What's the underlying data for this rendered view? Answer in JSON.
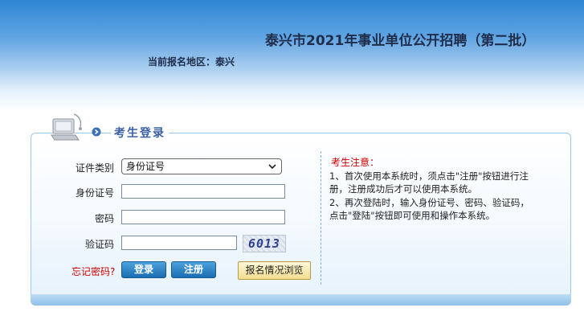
{
  "header": {
    "title": "泰兴市2021年事业单位公开招聘（第二批）",
    "region_label": "当前报名地区：",
    "region_value": "泰兴"
  },
  "login": {
    "title": "考生登录",
    "fields": {
      "id_type_label": "证件类别",
      "id_type_value": "身份证号",
      "id_number_label": "身份证号",
      "id_number_value": "",
      "password_label": "密码",
      "password_value": "",
      "captcha_label": "验证码",
      "captcha_value": "",
      "captcha_code": "6013"
    },
    "forgot_password": "忘记密码?",
    "login_button": "登录",
    "register_button": "注册",
    "browse_button": "报名情况浏览"
  },
  "notice": {
    "title": "考生注意：",
    "lines": [
      "1、首次使用本系统时，须点击\"注册\"按钮进行注",
      "册，注册成功后才可以使用本系统。",
      "2、再次登陆时，输入身份证号、密码、验证码，",
      "点击\"登陆\"按钮即可使用和操作本系统。"
    ]
  },
  "colors": {
    "header_top": "#2f86d3",
    "title_text": "#1f2d4a",
    "panel_border": "#9ec8ea",
    "accent_blue": "#1a6db3",
    "notice_red": "#cc0000"
  },
  "icons": [
    "login-computer-icon",
    "title-bullet-icon",
    "chevron-down-icon",
    "captcha-image"
  ]
}
